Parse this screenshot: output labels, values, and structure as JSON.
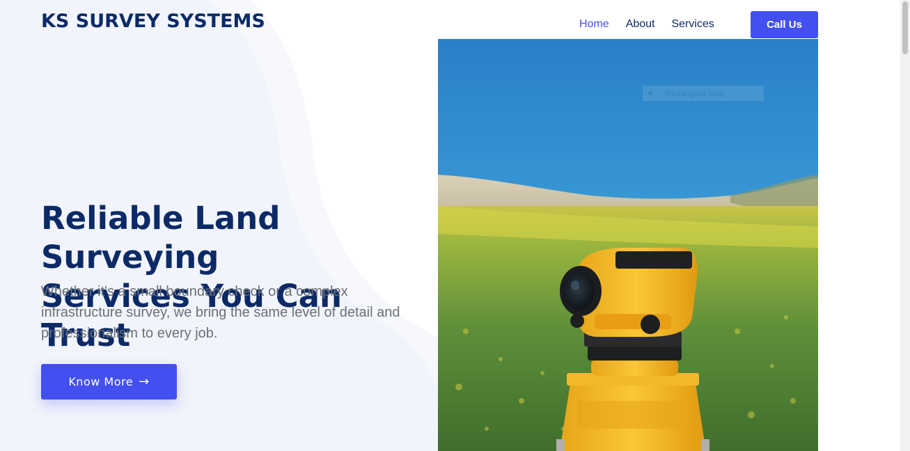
{
  "brand": {
    "name": "KS SURVEY SYSTEMS"
  },
  "nav": {
    "items": [
      {
        "label": "Home",
        "active": true
      },
      {
        "label": "About",
        "active": false
      },
      {
        "label": "Services",
        "active": false
      }
    ],
    "cta_label": "Call Us"
  },
  "hero": {
    "title_line1": "Reliable Land Surveying",
    "title_line2": "Services You Can Trust",
    "subtitle": "Whether it's a small boundary check or a complex infrastructure survey, we bring the same level of detail and professionalism to every job.",
    "button_label": "Know More",
    "button_icon": "arrow-right-icon",
    "image_overlay_text": "Rectangular Snip"
  },
  "colors": {
    "brand_navy": "#0b2a66",
    "accent_blue": "#4350ef",
    "active_nav": "#4a50e0",
    "body_text": "#6b6f76",
    "hero_bg": "#f2f4fb"
  }
}
